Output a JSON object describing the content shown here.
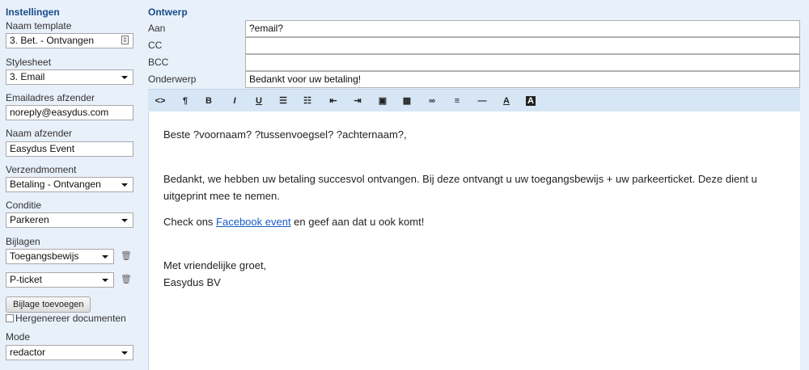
{
  "sidebar": {
    "title": "Instellingen",
    "template_label": "Naam template",
    "template_value": "3. Bet. - Ontvangen",
    "stylesheet_label": "Stylesheet",
    "stylesheet_value": "3. Email",
    "sender_email_label": "Emailadres afzender",
    "sender_email_value": "noreply@easydus.com",
    "sender_name_label": "Naam afzender",
    "sender_name_value": "Easydus Event",
    "send_moment_label": "Verzendmoment",
    "send_moment_value": "Betaling - Ontvangen",
    "condition_label": "Conditie",
    "condition_value": "Parkeren",
    "attachments_label": "Bijlagen",
    "attachments": [
      "Toegangsbewijs",
      "P-ticket"
    ],
    "add_attachment_label": "Bijlage toevoegen",
    "regenerate_label": "Hergenereer documenten",
    "mode_label": "Mode",
    "mode_value": "redactor"
  },
  "main": {
    "title": "Ontwerp",
    "to_label": "Aan",
    "to_value": "?email?",
    "cc_label": "CC",
    "cc_value": "",
    "bcc_label": "BCC",
    "bcc_value": "",
    "subject_label": "Onderwerp",
    "subject_value": "Bedankt voor uw betaling!"
  },
  "toolbar": {
    "icons": [
      "code-icon",
      "paragraph-icon",
      "bold-icon",
      "italic-icon",
      "underline-icon",
      "unordered-list-icon",
      "ordered-list-icon",
      "outdent-icon",
      "indent-icon",
      "image-icon",
      "table-icon",
      "link-icon",
      "align-left-icon",
      "horizontal-rule-icon",
      "font-color-icon",
      "background-color-icon"
    ]
  },
  "editor": {
    "greeting": "Beste ?voornaam? ?tussenvoegsel? ?achternaam?,",
    "body": "Bedankt, we hebben uw betaling succesvol ontvangen. Bij deze ontvangt u uw toegangsbewijs + uw parkeerticket. Deze dient u uitgeprint mee te nemen.",
    "check_prefix": "Check ons ",
    "check_link": "Facebook event",
    "check_suffix": " en geef aan dat u ook komt!",
    "closing": "Met vriendelijke groet,",
    "signature": "Easydus BV"
  }
}
